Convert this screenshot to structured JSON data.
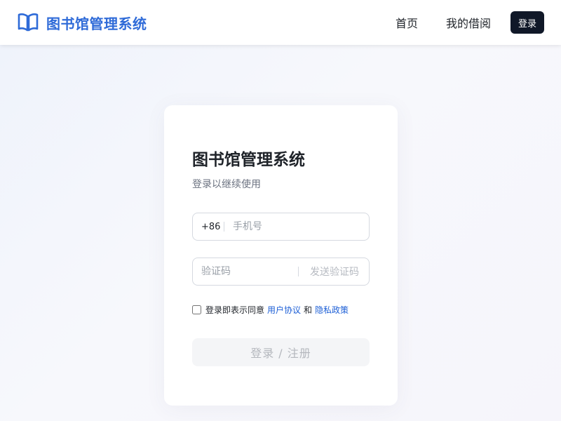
{
  "header": {
    "brand_title": "图书馆管理系统",
    "brand_icon": "book-open-icon",
    "nav": {
      "home": "首页",
      "my_borrows": "我的借阅"
    },
    "login_button": "登录"
  },
  "colors": {
    "brand": "#2f6bd8",
    "login_button_bg": "#101828",
    "link": "#1d5fd6"
  },
  "login_card": {
    "title": "图书馆管理系统",
    "subtitle": "登录以继续使用",
    "phone": {
      "prefix": "+86",
      "placeholder": "手机号",
      "value": ""
    },
    "code": {
      "placeholder": "验证码",
      "value": "",
      "send_label": "发送验证码"
    },
    "agreement": {
      "checked": false,
      "prefix_text": "登录即表示同意",
      "user_agreement": "用户协议",
      "and_text": "和",
      "privacy_policy": "隐私政策"
    },
    "submit_label": "登录 / 注册"
  }
}
